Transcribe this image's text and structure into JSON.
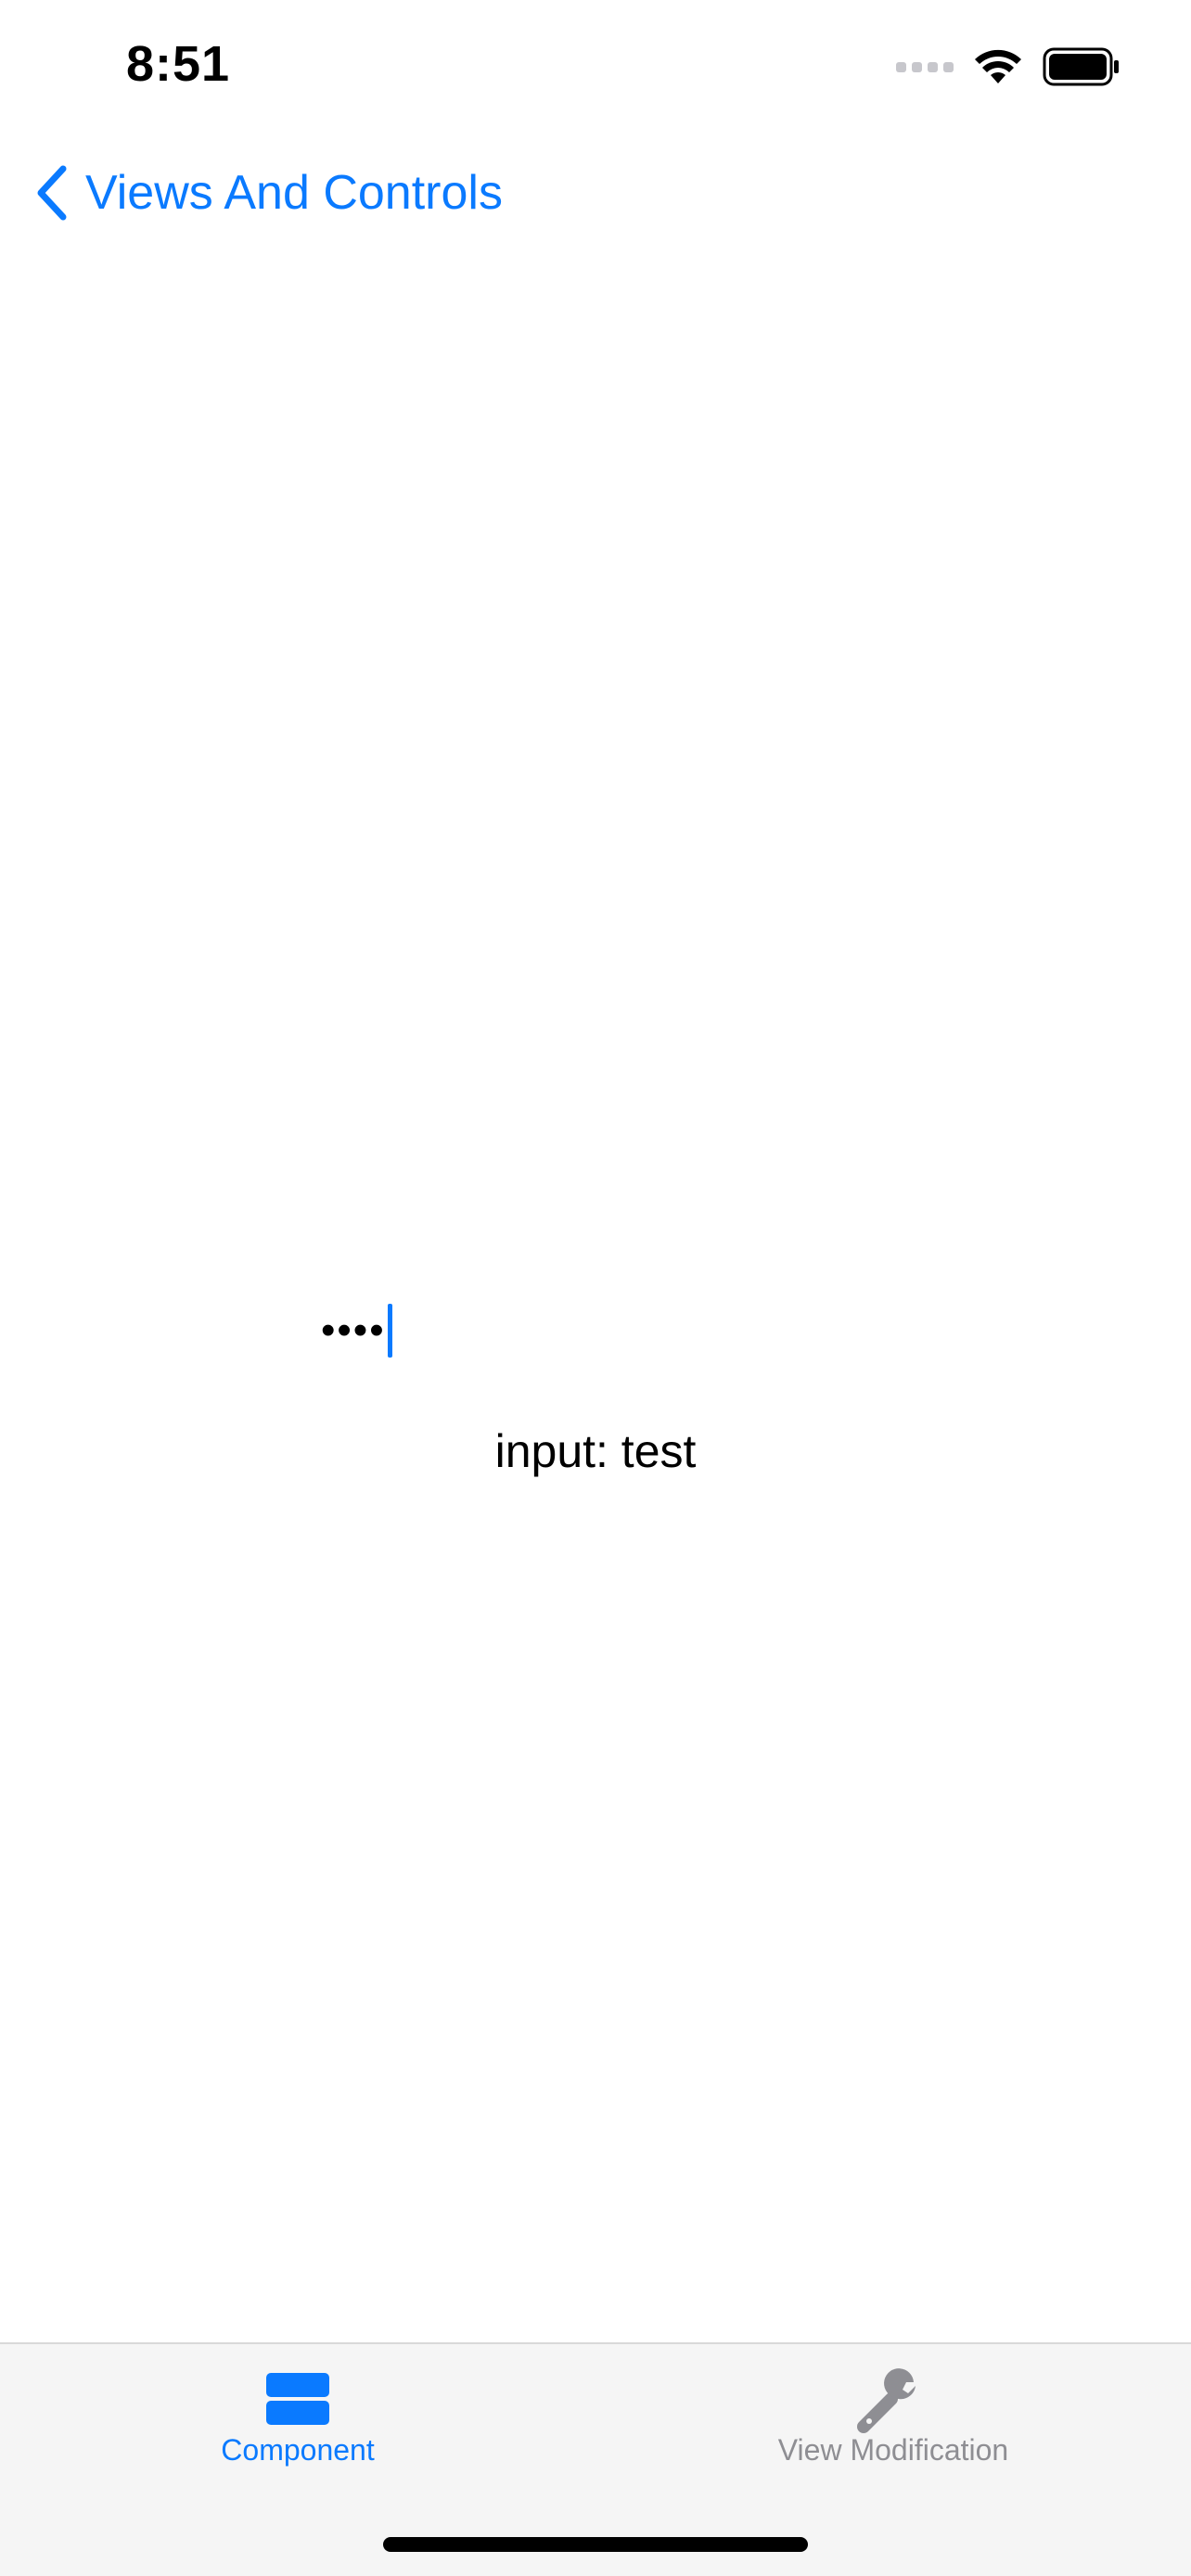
{
  "status_bar": {
    "time": "8:51",
    "icons": [
      "cellular-signal-icon",
      "wifi-icon",
      "battery-icon"
    ]
  },
  "nav": {
    "back_label": "Views And Controls",
    "back_icon": "chevron-left-icon"
  },
  "secure_field": {
    "value": "••••",
    "focused": true
  },
  "output": {
    "text": "input: test"
  },
  "tab_bar": {
    "tabs": [
      {
        "label": "Component",
        "icon": "stacked-rectangles-icon",
        "selected": true
      },
      {
        "label": "View Modification",
        "icon": "wrench-icon",
        "selected": false
      }
    ]
  },
  "colors": {
    "accent": "#0a7aff",
    "inactive": "#8e8e93",
    "tab_bar_bg": "#f5f5f5"
  }
}
